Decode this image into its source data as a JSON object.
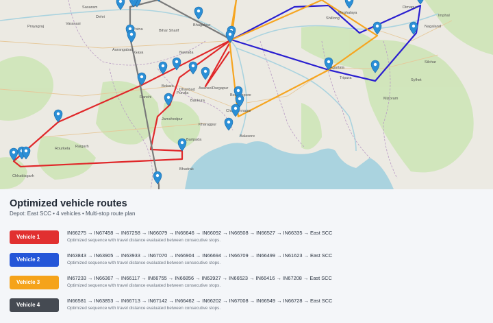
{
  "panel": {
    "title": "Optimized vehicle routes",
    "meta": "Depot: East SCC  •  4 vehicles  •  Multi-stop route plan"
  },
  "routes": [
    {
      "label": "Vehicle 1",
      "color": "#e13030",
      "sequence": "IN66275 → IN67458 → IN67258 → IN66079 → IN66646 → IN66092 → IN66508 → IN66527 → IN66335 → East SCC",
      "description": "Optimized sequence with travel distance evaluated between consecutive stops."
    },
    {
      "label": "Vehicle 2",
      "color": "#2456d8",
      "sequence": "IN63843 → IN63905 → IN63933 → IN67070 → IN66904 → IN66694 → IN66709 → IN66499 → IN61623 → East SCC",
      "description": "Optimized sequence with travel distance evaluated between consecutive stops."
    },
    {
      "label": "Vehicle 3",
      "color": "#f5a31a",
      "sequence": "IN67233 → IN66367 → IN66117 → IN66755 → IN66856 → IN63927 → IN66523 → IN66416 → IN67208 → East SCC",
      "description": "Optimized sequence with travel distance evaluated between consecutive stops."
    },
    {
      "label": "Vehicle 4",
      "color": "#454a52",
      "sequence": "IN66581 → IN63853 → IN66713 → IN67142 → IN66462 → IN66202 → IN67008 → IN66549 → IN66728 → East SCC",
      "description": "Optimized sequence with travel distance evaluated between consecutive stops."
    }
  ],
  "map": {
    "colors": {
      "land": "#eceae3",
      "water": "#aad3df",
      "forest": "#cde5b5",
      "marker": "#2b8fd6",
      "line_red": "#e0282a",
      "line_blue": "#2a1fd0",
      "line_orange": "#f6a520",
      "line_gray": "#7a7a7a"
    },
    "labels": [
      "Prayagraj",
      "Varanasi",
      "Patna",
      "Bihar Sharif",
      "Aurangabad",
      "Gaya",
      "Nawada",
      "Bhagalpur",
      "Ranchi",
      "Bokaro",
      "Dhanbad",
      "Asansol",
      "Durgapur",
      "Purulia",
      "Jamshedpur",
      "Chandannagar",
      "Kharagpur",
      "Baripada",
      "Raigarh",
      "Bhadrak",
      "Chhattisgarh",
      "Bankura",
      "Shillong",
      "Agartala",
      "Tripura",
      "Mizoram",
      "Sylhet",
      "Silchar",
      "Imphal",
      "Dimapur",
      "Meghalaya",
      "Nagaland",
      "Balasore",
      "Rourkela",
      "Berhampore",
      "Sasaram",
      "Dehri"
    ]
  }
}
